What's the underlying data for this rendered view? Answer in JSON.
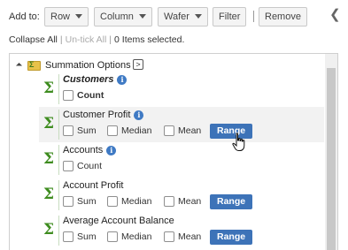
{
  "toolbar": {
    "add_to_label": "Add to:",
    "row_label": "Row",
    "column_label": "Column",
    "wafer_label": "Wafer",
    "filter_label": "Filter",
    "remove_label": "Remove"
  },
  "actions": {
    "collapse_all": "Collapse All",
    "untick_all": "Un-tick All",
    "selection_status": "0 Items selected."
  },
  "tree": {
    "root_label": "Summation Options",
    "goto_glyph": ">",
    "info_glyph": "i",
    "sigma_glyph": "Σ",
    "items": [
      {
        "title": "Customers",
        "options": [
          "Count"
        ]
      },
      {
        "title": "Customer Profit",
        "options": [
          "Sum",
          "Median",
          "Mean"
        ],
        "button": "Range"
      },
      {
        "title": "Accounts",
        "options": [
          "Count"
        ]
      },
      {
        "title": "Account Profit",
        "options": [
          "Sum",
          "Median",
          "Mean"
        ],
        "button": "Range"
      },
      {
        "title": "Average Account Balance",
        "options": [
          "Sum",
          "Median",
          "Mean"
        ],
        "button": "Range"
      }
    ]
  },
  "colors": {
    "range_button": "#3d73b8",
    "sigma": "#3e8c1f",
    "info_icon": "#3f7ac4"
  }
}
